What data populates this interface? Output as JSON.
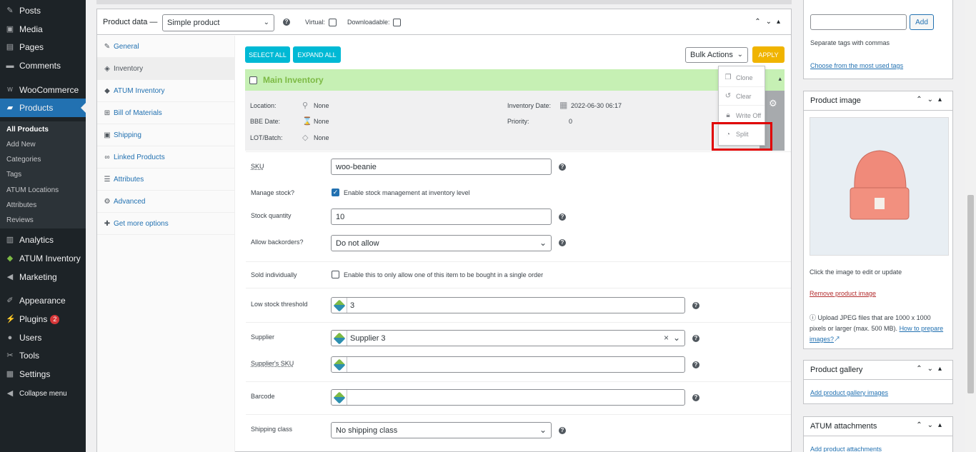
{
  "sidebar": {
    "items": [
      {
        "label": "Posts",
        "icon": "pin-icon"
      },
      {
        "label": "Media",
        "icon": "media-icon"
      },
      {
        "label": "Pages",
        "icon": "pages-icon"
      },
      {
        "label": "Comments",
        "icon": "comments-icon"
      },
      {
        "label": "WooCommerce",
        "icon": "woocommerce-icon"
      },
      {
        "label": "Products",
        "icon": "products-icon"
      }
    ],
    "submenu": [
      "All Products",
      "Add New",
      "Categories",
      "Tags",
      "ATUM Locations",
      "Attributes",
      "Reviews"
    ],
    "items2": [
      {
        "label": "Analytics",
        "icon": "analytics-icon"
      },
      {
        "label": "ATUM Inventory",
        "icon": "atum-icon"
      },
      {
        "label": "Marketing",
        "icon": "marketing-icon"
      },
      {
        "label": "Appearance",
        "icon": "appearance-icon"
      },
      {
        "label": "Plugins",
        "icon": "plugins-icon",
        "badge": "2"
      },
      {
        "label": "Users",
        "icon": "users-icon"
      },
      {
        "label": "Tools",
        "icon": "tools-icon"
      },
      {
        "label": "Settings",
        "icon": "settings-icon"
      }
    ],
    "collapse": "Collapse menu"
  },
  "product_data": {
    "title": "Product data —",
    "type": "Simple product",
    "virtual": "Virtual:",
    "downloadable": "Downloadable:"
  },
  "tabs": [
    "General",
    "Inventory",
    "ATUM Inventory",
    "Bill of Materials",
    "Shipping",
    "Linked Products",
    "Attributes",
    "Advanced",
    "Get more options"
  ],
  "toolbar": {
    "select_all": "SELECT ALL",
    "expand_all": "EXPAND ALL",
    "bulk": "Bulk Actions",
    "apply": "APPLY"
  },
  "main_inventory": {
    "title": "Main Inventory",
    "location_label": "Location:",
    "location": "None",
    "bbe_label": "BBE Date:",
    "bbe": "None",
    "lot_label": "LOT/Batch:",
    "lot": "None",
    "inv_date_label": "Inventory Date:",
    "inv_date": "2022-06-30 06:17",
    "priority_label": "Priority:",
    "priority": "0"
  },
  "dropdown": [
    "Clone",
    "Clear",
    "Write Off",
    "Split"
  ],
  "fields": {
    "sku_label": "SKU",
    "sku": "woo-beanie",
    "manage_label": "Manage stock?",
    "manage_text": "Enable stock management at inventory level",
    "qty_label": "Stock quantity",
    "qty": "10",
    "backorders_label": "Allow backorders?",
    "backorders": "Do not allow",
    "sold_label": "Sold individually",
    "sold_text": "Enable this to only allow one of this item to be bought in a single order",
    "low_label": "Low stock threshold",
    "low": "3",
    "supplier_label": "Supplier",
    "supplier": "Supplier 3",
    "supplier_sku_label": "Supplier's SKU",
    "barcode_label": "Barcode",
    "shipping_label": "Shipping class",
    "shipping": "No shipping class"
  },
  "right": {
    "add": "Add",
    "tags_hint": "Separate tags with commas",
    "tags_link": "Choose from the most used tags",
    "image_title": "Product image",
    "image_hint": "Click the image to edit or update",
    "remove_image": "Remove product image",
    "upload_info": "Upload JPEG files that are 1000 x 1000 pixels or larger (max. 500 MB).",
    "prepare_link": "How to prepare images?",
    "gallery_title": "Product gallery",
    "gallery_link": "Add product gallery images",
    "attach_title": "ATUM attachments",
    "attach_link": "Add product attachments"
  },
  "colors": {
    "accent": "#2271b1",
    "teal": "#00b9d5",
    "apply": "#f0b400",
    "green_header": "#c6f0b4",
    "highlight": "#e00000"
  }
}
